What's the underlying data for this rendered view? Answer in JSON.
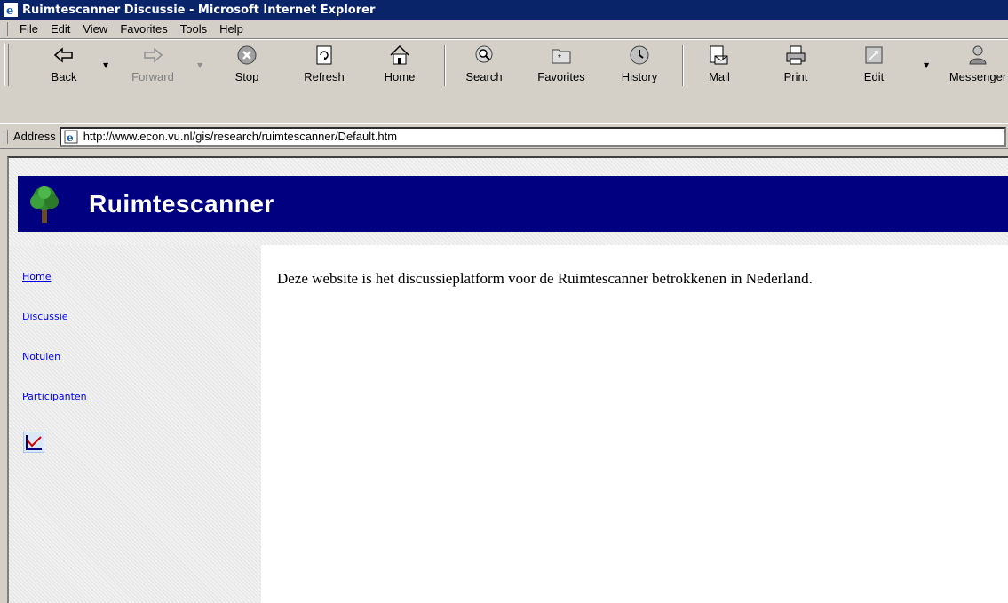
{
  "window": {
    "title": "Ruimtescanner Discussie - Microsoft Internet Explorer"
  },
  "menu": [
    "File",
    "Edit",
    "View",
    "Favorites",
    "Tools",
    "Help"
  ],
  "toolbar": {
    "back": "Back",
    "forward": "Forward",
    "stop": "Stop",
    "refresh": "Refresh",
    "home": "Home",
    "search": "Search",
    "favorites": "Favorites",
    "history": "History",
    "mail": "Mail",
    "print": "Print",
    "edit": "Edit",
    "messenger": "Messenger"
  },
  "address": {
    "label": "Address",
    "url": "http://www.econ.vu.nl/gis/research/ruimtescanner/Default.htm"
  },
  "page": {
    "site_title": "Ruimtescanner",
    "nav": [
      "Home",
      "Discussie",
      "Notulen",
      "Participanten"
    ],
    "intro": "Deze website is het discussieplatform voor de Ruimtescanner betrokkenen in Nederland."
  },
  "colors": {
    "titlebar": "#0a246a",
    "banner": "#000080",
    "chrome": "#d4d0c8",
    "link": "#0000ee"
  },
  "icons": {
    "back": "back-arrow-icon",
    "forward": "forward-arrow-icon",
    "stop": "stop-icon",
    "refresh": "refresh-icon",
    "home": "home-icon",
    "search": "search-icon",
    "favorites": "favorites-icon",
    "history": "history-icon",
    "mail": "mail-icon",
    "print": "print-icon",
    "edit": "edit-icon",
    "messenger": "messenger-icon",
    "site_logo": "tree-icon",
    "nav_chart": "chart-icon"
  }
}
